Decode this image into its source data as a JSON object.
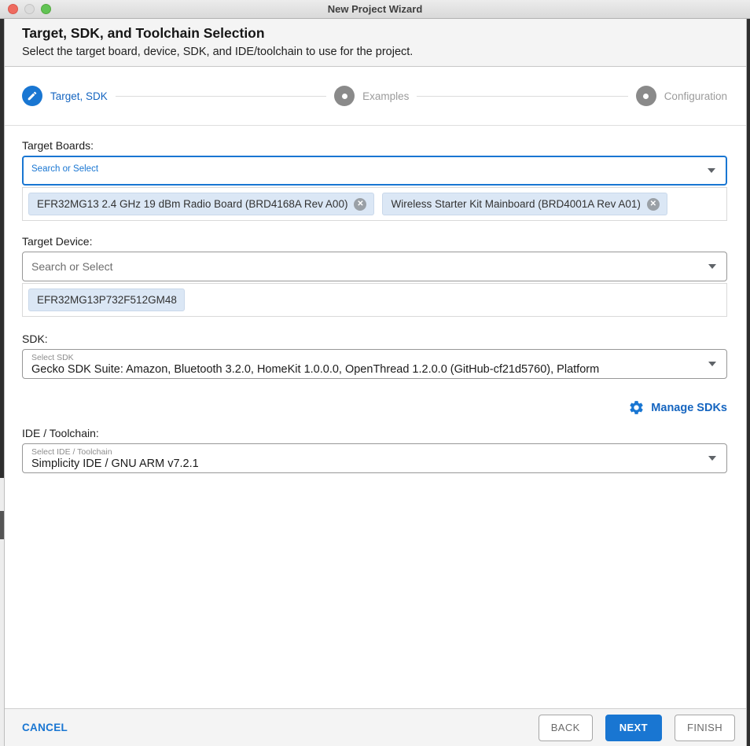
{
  "window": {
    "title": "New Project Wizard"
  },
  "header": {
    "title": "Target, SDK, and Toolchain Selection",
    "subtitle": "Select the target board, device, SDK, and IDE/toolchain to use for the project."
  },
  "stepper": {
    "steps": [
      {
        "label": "Target, SDK",
        "state": "active",
        "icon": "edit-icon"
      },
      {
        "label": "Examples",
        "state": "inactive",
        "icon": "dot-icon"
      },
      {
        "label": "Configuration",
        "state": "inactive",
        "icon": "dot-icon"
      }
    ]
  },
  "target_boards": {
    "label": "Target Boards:",
    "search_placeholder": "Search or Select",
    "chips": [
      {
        "text": "EFR32MG13 2.4 GHz 19 dBm Radio Board (BRD4168A Rev A00)",
        "removable": true
      },
      {
        "text": "Wireless Starter Kit Mainboard (BRD4001A Rev A01)",
        "removable": true
      }
    ]
  },
  "target_device": {
    "label": "Target Device:",
    "search_placeholder": "Search or Select",
    "chips": [
      {
        "text": "EFR32MG13P732F512GM48",
        "removable": false
      }
    ]
  },
  "sdk": {
    "label": "SDK:",
    "field_label": "Select SDK",
    "value": "Gecko SDK Suite: Amazon, Bluetooth 3.2.0, HomeKit 1.0.0.0, OpenThread 1.2.0.0 (GitHub-cf21d5760), Platform",
    "manage_label": "Manage SDKs"
  },
  "ide": {
    "label": "IDE / Toolchain:",
    "field_label": "Select IDE / Toolchain",
    "value": "Simplicity IDE / GNU ARM v7.2.1"
  },
  "footer": {
    "cancel": "CANCEL",
    "back": "BACK",
    "next": "NEXT",
    "finish": "FINISH"
  },
  "colors": {
    "accent": "#1976d2",
    "link": "#1565c0",
    "step_inactive": "#8a8a8a",
    "chip_bg": "#dbe7f5"
  }
}
